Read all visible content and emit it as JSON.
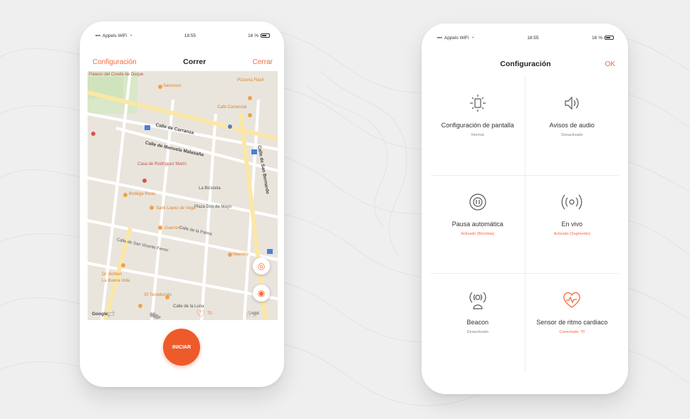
{
  "left_phone": {
    "status": {
      "carrier": "Appels WiFi",
      "time": "18:55",
      "battery": "16 %"
    },
    "nav": {
      "back": "Configuración",
      "title": "Correr",
      "close": "Cerrar"
    },
    "map": {
      "labels": [
        "Calle de Carranza",
        "Calle de Manuela Malasaña",
        "Calle de San Bernardo",
        "Calle de la Palma",
        "Calle de San Vicente Ferrer",
        "Palacio del Conde de Duque",
        "Sanrusso",
        "Café Comercial",
        "Pizzería Flash",
        "Casa de Rodríguez Marín",
        "Bodega Rivas",
        "La Bicicleta",
        "Saint Lopez de Vega",
        "Plaza Dos de Mayo",
        "Guerrero",
        "Maestro",
        "Dr. Bohlen",
        "La Buena Vida",
        "El Tenedorcito",
        "Calle de la Luna"
      ],
      "google": "Google",
      "legal": "Legal",
      "fab_top": "◎",
      "fab_bottom": "◉"
    },
    "tabs": [
      {
        "icon": "route-icon",
        "glyph": "⇄",
        "badge": ""
      },
      {
        "icon": "shoe-icon",
        "glyph": "👟",
        "badge": ""
      },
      {
        "icon": "heart-rate-icon",
        "glyph": "♡",
        "badge": "70"
      },
      {
        "icon": "broadcast-icon",
        "glyph": "((•))",
        "badge": ""
      }
    ],
    "start_label": "INICIAR"
  },
  "right_phone": {
    "status": {
      "carrier": "Appels WiFi",
      "time": "18:55",
      "battery": "16 %"
    },
    "nav": {
      "title": "Configuración",
      "ok": "OK"
    },
    "tiles": [
      {
        "icon": "brightness-icon",
        "title": "Configuración de pantalla",
        "subtitle": "Normal",
        "subtitle_color": "gray"
      },
      {
        "icon": "speaker-icon",
        "title": "Avisos de audio",
        "subtitle": "Desactivado",
        "subtitle_color": "gray"
      },
      {
        "icon": "pause-icon",
        "title": "Pausa automática",
        "subtitle": "Activado (Bicicleta)",
        "subtitle_color": "orange"
      },
      {
        "icon": "live-icon",
        "title": "En vivo",
        "subtitle": "Activado (Segmento)",
        "subtitle_color": "orange"
      },
      {
        "icon": "beacon-icon",
        "title": "Beacon",
        "subtitle": "Desactivado",
        "subtitle_color": "gray"
      },
      {
        "icon": "heart-sensor-icon",
        "title": "Sensor de ritmo cardiaco",
        "subtitle": "Conectado: 70",
        "subtitle_color": "orange"
      }
    ]
  },
  "colors": {
    "accent": "#f2693a",
    "start_button": "#ed5b2a",
    "background": "#efefef"
  }
}
